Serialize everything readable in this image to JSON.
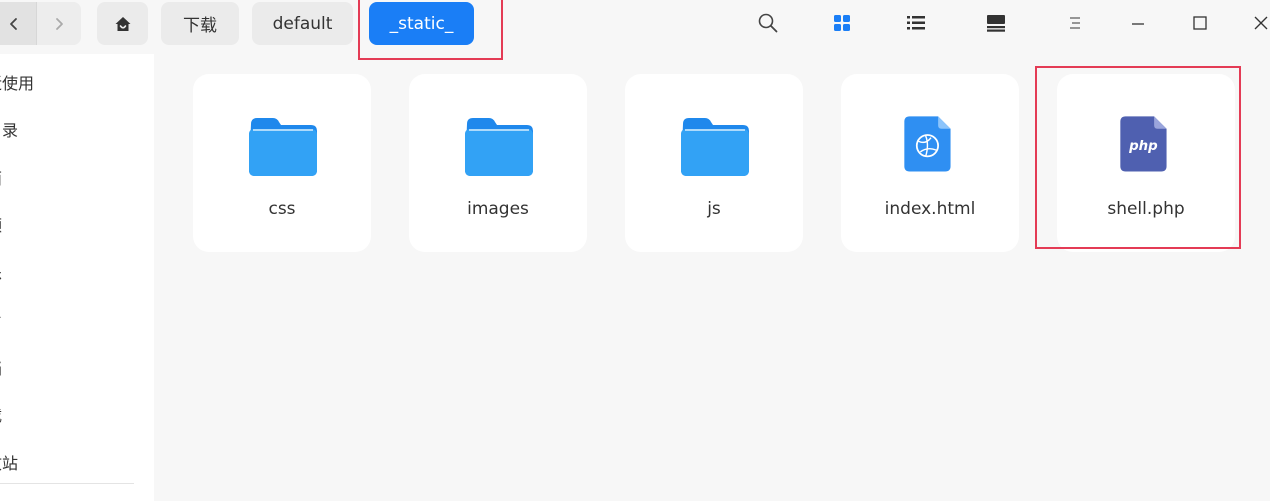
{
  "navigation": {
    "back_icon": "chevron-left-icon",
    "forward_icon": "chevron-right-icon",
    "home_icon": "home-icon",
    "breadcrumbs": [
      "下载",
      "default",
      "_static_"
    ]
  },
  "toolbar": {
    "icons": [
      "search-icon",
      "grid-view-icon",
      "list-view-icon",
      "detail-view-icon",
      "menu-icon",
      "minimize-icon",
      "maximize-icon",
      "close-icon"
    ]
  },
  "sidebar": {
    "items": [
      "近使用",
      "目录",
      "面",
      "频",
      "乐",
      "片",
      "档",
      "载",
      "收站"
    ]
  },
  "files": [
    {
      "name": "css",
      "type": "folder"
    },
    {
      "name": "images",
      "type": "folder"
    },
    {
      "name": "js",
      "type": "folder"
    },
    {
      "name": "index.html",
      "type": "html"
    },
    {
      "name": "shell.php",
      "type": "php",
      "badge": "php"
    }
  ],
  "colors": {
    "accent": "#1a7ef6",
    "folder": "#2b9af3",
    "php": "#4f60b0",
    "highlight": "#e43b55"
  }
}
